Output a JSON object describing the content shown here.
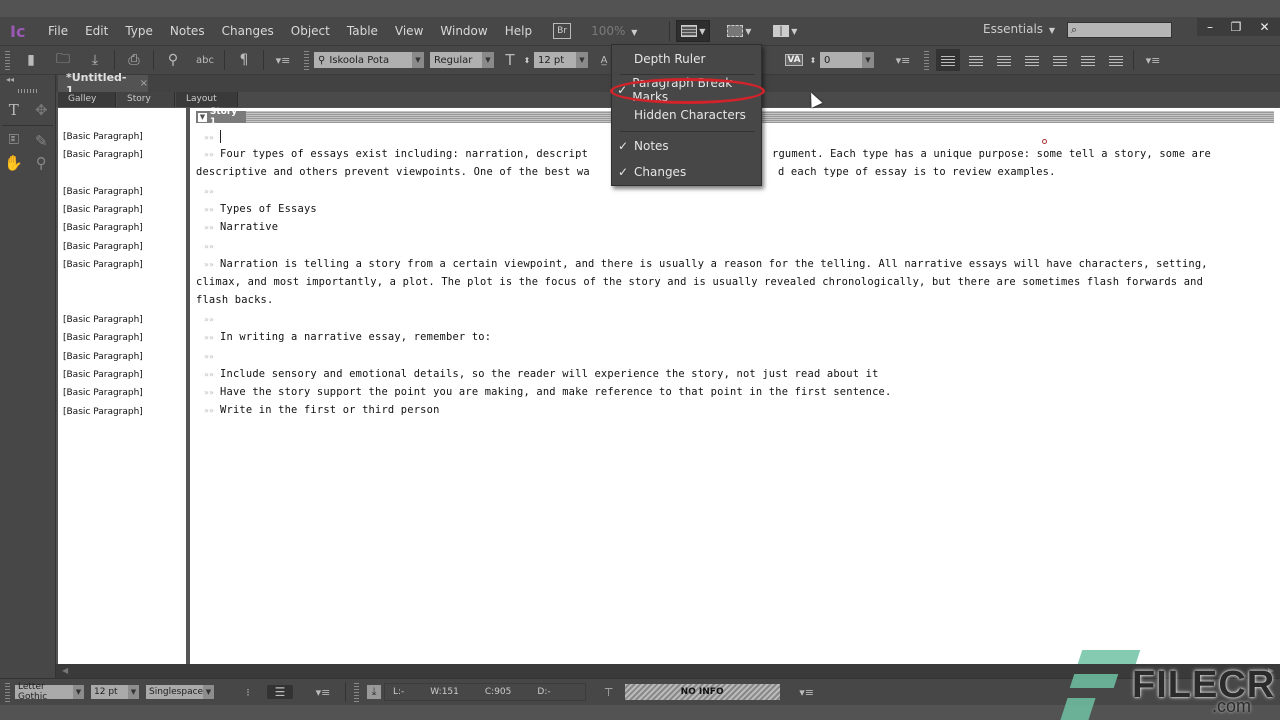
{
  "app": {
    "logo": "Ic",
    "menus": [
      "File",
      "Edit",
      "Type",
      "Notes",
      "Changes",
      "Object",
      "Table",
      "View",
      "Window",
      "Help"
    ],
    "bridge_label": "Br",
    "zoom_level": "100%",
    "workspace": "Essentials",
    "search_placeholder": ""
  },
  "window_controls": {
    "minimize": "–",
    "restore": "❐",
    "close": "✕"
  },
  "toolbar": {
    "font_family": "Iskoola Pota",
    "font_style": "Regular",
    "font_size": "12 pt",
    "tracking": "0",
    "tracking_label": "VA"
  },
  "view_menu": {
    "items": [
      {
        "label": "Depth Ruler",
        "checked": false,
        "check": ""
      },
      {
        "label": "Paragraph Break Marks",
        "checked": true,
        "check": "✓",
        "highlighted": true
      },
      {
        "label": "Hidden Characters",
        "checked": false,
        "check": ""
      },
      {
        "label": "Notes",
        "checked": true,
        "check": "✓"
      },
      {
        "label": "Changes",
        "checked": true,
        "check": "✓"
      }
    ]
  },
  "document": {
    "tab_title": "*Untitled-1",
    "close_glyph": "×",
    "view_tabs": [
      "Galley",
      "Story",
      "Layout"
    ],
    "active_view": "Story",
    "story_title": "Story 1",
    "paragraph_mark": "»»",
    "style_labels": [
      "[Basic Paragraph]",
      "[Basic Paragraph]",
      "[Basic Paragraph]",
      "[Basic Paragraph]",
      "[Basic Paragraph]",
      "[Basic Paragraph]",
      "[Basic Paragraph]",
      "[Basic Paragraph]",
      "[Basic Paragraph]",
      "[Basic Paragraph]",
      "[Basic Paragraph]",
      "[Basic Paragraph]",
      "[Basic Paragraph]"
    ],
    "lines": [
      "",
      "Four types of essays exist including: narration, descript",
      "descriptive and others prevent viewpoints. One of the best wa",
      "",
      "Types of Essays",
      "Narrative",
      "",
      "Narration is telling a story from a certain viewpoint, and there is usually a reason for the telling. All narrative essays will have characters, setting,",
      "climax, and most importantly, a plot. The plot is the focus of the story and is usually revealed chronologically, but there are sometimes flash forwards and",
      "flash backs.",
      "",
      "In writing a narrative essay, remember to:",
      "",
      "Include sensory and emotional details, so the reader will experience the story, not just read about it",
      "Have the story support the point you are making, and make reference to that point in the first sentence.",
      "Write in the first or third person"
    ],
    "line1_tail": "rgument. Each type has a unique purpose: some tell a story, some are",
    "line2_tail": "d each type of essay is to review examples."
  },
  "statusbar": {
    "font": "Letter Gothic",
    "size": "12 pt",
    "spacing": "Singlespace",
    "line": "L:-",
    "words": "W:151",
    "chars": "C:905",
    "depth": "D:-",
    "info": "NO INFO"
  },
  "watermark": {
    "brand": "FILECR",
    "domain": ".com"
  }
}
